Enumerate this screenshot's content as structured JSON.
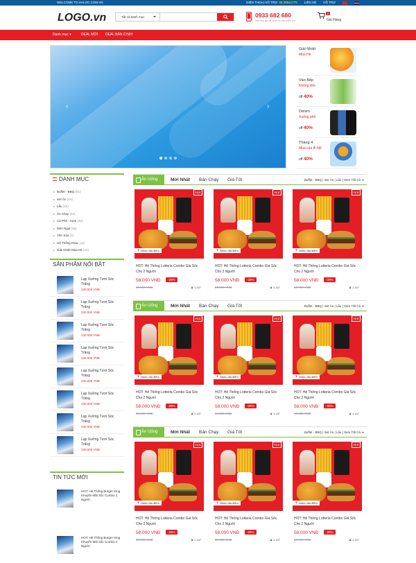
{
  "topbar": {
    "welcome": "WELCOME TO HALOC.COM.VN",
    "hotline_label": "ĐIỆN THOẠI HỖ TRỢ:",
    "hotline": "08.39941778",
    "contact": "LIÊN HỆ",
    "support": "HỖ TRỢ"
  },
  "header": {
    "logo": "LOGO.vn",
    "search_category": "Tất cả danh mục",
    "search_placeholder": "",
    "phone": "0933 682 680",
    "phone_sub": "Hãy tiếp gọi để được tư vấn miễn phí",
    "cart_count": "0",
    "cart_label": "Giỏ Hàng"
  },
  "nav": {
    "items": [
      "Danh mục ▾",
      "DEAL MỚI",
      "DEAL BÁN CHẠY"
    ]
  },
  "promos": [
    {
      "title": "Giải Nhiệt",
      "sub": "Mùa Hè",
      "off_prefix": "",
      "off": ""
    },
    {
      "title": "Vào Bếp",
      "sub": "Không khó",
      "off_prefix": "off",
      "off": "40%"
    },
    {
      "title": "Denim",
      "sub": "Xuống phố",
      "off_prefix": "off",
      "off": "40%"
    },
    {
      "title": "Tháng 4",
      "sub": "Mùa của lễ hội",
      "off_prefix": "off",
      "off": "40%"
    }
  ],
  "sidebar": {
    "danhmuc_title": "DANH MỤC",
    "categories": [
      {
        "name": "Buffet - BBQ",
        "count": "(81)"
      },
      {
        "name": "Set Ăn",
        "count": "(54)"
      },
      {
        "name": "Lẩu",
        "count": "(46)"
      },
      {
        "name": "Ăn Chay",
        "count": "(54)"
      },
      {
        "name": "Cà Phê - Kem",
        "count": "(45)"
      },
      {
        "name": "Món Ngọt",
        "count": "(55)"
      },
      {
        "name": "Yến Xào",
        "count": "(3)"
      },
      {
        "name": "Hệ Thống Khác",
        "count": "(11)"
      },
      {
        "name": "Giải Nhiệt Mùa Hè",
        "count": "(32)"
      }
    ],
    "hot_title": "SẢN PHẨM NỔI BẬT",
    "hot_items": [
      {
        "name": "Lạp Xưởng Tươi Sóc Trăng",
        "price": "230.000 VNĐ"
      },
      {
        "name": "Lạp Xưởng Tươi Sóc Trăng",
        "price": "230.000 VNĐ"
      },
      {
        "name": "Lạp Xưởng Tươi Sóc Trăng",
        "price": "230.000 VNĐ"
      },
      {
        "name": "Lạp Xưởng Tươi Sóc Trăng",
        "price": "230.000 VNĐ"
      },
      {
        "name": "Lạp Xưởng Tươi Sóc Trăng",
        "price": "230.000 VNĐ"
      },
      {
        "name": "Lạp Xưởng Tươi Sóc Trăng",
        "price": "230.000 VNĐ"
      },
      {
        "name": "Lạp Xưởng Tươi Sóc Trăng",
        "price": "230.000 VNĐ"
      },
      {
        "name": "Lạp Xưởng Tươi Sóc Trăng",
        "price": "230.000 VNĐ"
      }
    ],
    "news_title": "TIN TỨC MỚI",
    "news_items": [
      {
        "name": "HOT: Hệ Thống Burger King Khuyến Mãi Sốc Combo 2 Người"
      },
      {
        "name": "HOT: Hệ Thống Burger King Khuyến Mãi Sốc Combo 2 Người"
      }
    ]
  },
  "sections": [
    {
      "tab_main": "Ăn Uống",
      "tabs": [
        "Mới Nhất",
        "Bán Chạy",
        "Giá Tốt"
      ],
      "links": "Buffet - BBQ  |  Set Ăn  |  Lẩu  |  Xem Tất Cả ➜"
    },
    {
      "tab_main": "Ăn Uống",
      "tabs": [
        "Mới Nhất",
        "Bán Chạy",
        "Giá Tốt"
      ],
      "links": "Buffet - BBQ  |  Set Ăn  |  Lẩu  |  Xem Tất Cả ➜"
    },
    {
      "tab_main": "Ăn Uống",
      "tabs": [
        "Mới Nhất",
        "Bán Chạy",
        "Giá Tốt"
      ],
      "links": "Buffet - BBQ  |  Set Ăn  |  Lẩu  |  Xem Tất Cả ➜"
    }
  ],
  "product": {
    "name": "HOT: Hệ Thống Lotteria Combo Giá Sốc Cho 2 Người",
    "price": "58.000 VNĐ",
    "discount": "-28%",
    "old_price": "80.000 VNĐ",
    "views": "1,187",
    "hot": "Hot",
    "label": "Nhiều địa điểm"
  },
  "colors": {
    "accent": "#e31f25",
    "green": "#7cc243",
    "topbar": "#0d5a9a"
  }
}
